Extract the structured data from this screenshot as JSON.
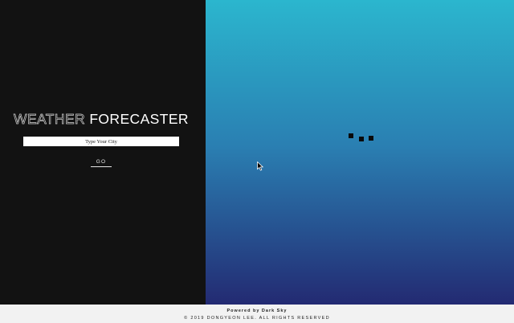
{
  "header": {
    "title_outline": "WEATHER",
    "title_solid": "FORECASTER"
  },
  "search": {
    "placeholder": "Type Your City",
    "go_label": "GO"
  },
  "loading_indicator": {
    "dot_color": "#0a0a0a"
  },
  "footer": {
    "powered_by": "Powered by Dark Sky",
    "copyright": "© 2019 DONGYEON LEE. ALL RIGHTS RESERVED"
  },
  "colors": {
    "left_panel_bg": "#121212",
    "gradient_top": "#2bb6ce",
    "gradient_bottom": "#232a72",
    "footer_bg": "#f2f2f2"
  },
  "icons": {
    "cursor": "mouse-pointer-icon"
  }
}
